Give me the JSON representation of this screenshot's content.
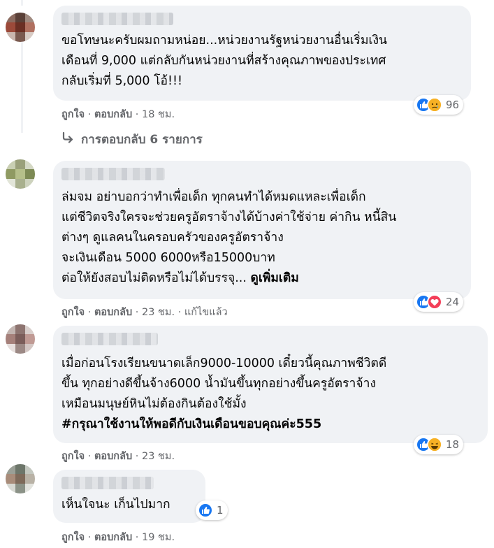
{
  "comments": [
    {
      "text": "ขอโทษนะครับผมถามหน่อย...หน่วยงานรัฐหน่วยงานอื่นเริ่มเงิน\nเดือนที่ 9,000 แต่กลับกันหน่วยงานที่สร้างคุณภาพของประเทศ\nกลับเริ่มที่ 5,000 โอ้!!!",
      "like": "ถูกใจ",
      "reply": "ตอบกลับ",
      "time": "18 ชม.",
      "reaction_count": "96",
      "reactions": [
        "like-icon",
        "sad-icon"
      ]
    },
    {
      "text": "ล่มจม อย่าบอกว่าทำเพื่อเด็ก ทุกคนทำได้หมดแหละเพื่อเด็ก\nแต่ชีวิตจริงใครจะช่วยครูอัตราจ้างได้บ้างค่าใช้จ่าย ค่ากิน หนี้สิน\nต่างๆ ดูแลคนในครอบครัวของครูอัตราจ้าง\nจะเงินเดือน 5000 6000หรือ15000บาท\nต่อให้ยังสอบไม่ติดหรือไม่ได้บรรจุ...",
      "see_more": "ดูเพิ่มเติม",
      "like": "ถูกใจ",
      "reply": "ตอบกลับ",
      "time": "23 ชม.",
      "edited": "แก้ไขแล้ว",
      "reaction_count": "24",
      "reactions": [
        "like-icon",
        "heart-icon"
      ]
    },
    {
      "text": "เมื่อก่อนโรงเรียนขนาดเล็ก9000-10000 เดี๋ยวนี้คุณภาพชีวิตดี\nขึ้น ทุกอย่างดีขึ้นจ้าง6000 น้ำมันขึ้นทุกอย่างขึ้นครูอัตราจ้าง\nเหมือนมนุษย์หินไม่ต้องกินต้องใช้มั้ง",
      "hashtag": "#กรุณาใช้งานให้พอดีกับเงินเดือนขอบคุณค่ะ555",
      "like": "ถูกใจ",
      "reply": "ตอบกลับ",
      "time": "23 ชม.",
      "reaction_count": "18",
      "reactions": [
        "like-icon",
        "haha-icon"
      ]
    },
    {
      "text": "เห็นใจนะ เก็นไปมาก",
      "like": "ถูกใจ",
      "reply": "ตอบกลับ",
      "time": "19 ชม.",
      "reaction_count": "1",
      "reactions": [
        "like-icon"
      ]
    }
  ],
  "replies_link": "การตอบกลับ 6 รายการ",
  "colors": {
    "bubble": "#f0f2f5",
    "meta_text": "#65676b",
    "like_blue": "#1877f2",
    "heart_red": "#f33e58",
    "emoji_yellow": "#f7b125"
  }
}
